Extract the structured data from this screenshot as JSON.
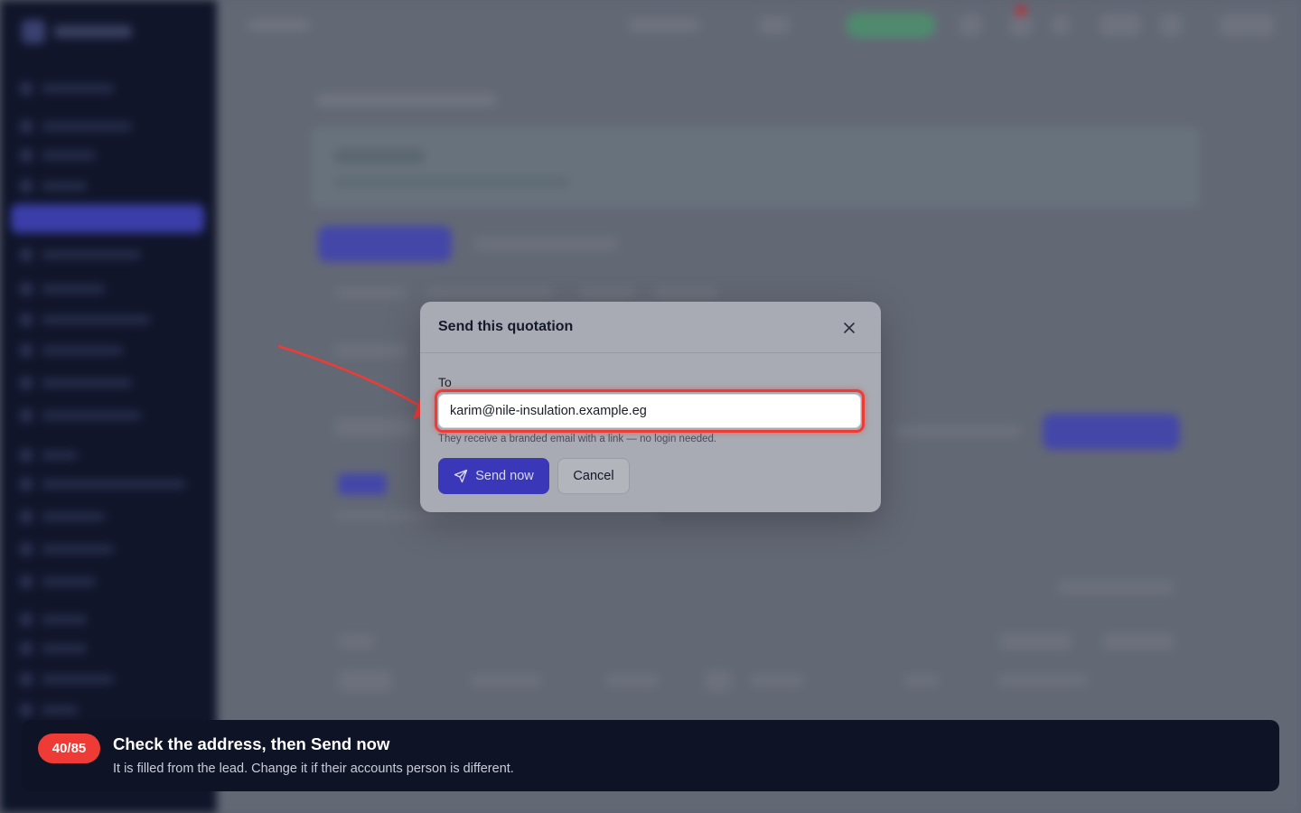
{
  "modal": {
    "title": "Send this quotation",
    "to_label": "To",
    "email_value": "karim@nile-insulation.example.eg",
    "helper_text": "They receive a branded email with a link — no login needed.",
    "send_label": "Send now",
    "cancel_label": "Cancel"
  },
  "tutorial": {
    "step": "40/85",
    "title": "Check the address, then Send now",
    "text": "It is filled from the lead. Change it if their accounts person is different."
  },
  "colors": {
    "highlight": "#ef3b36",
    "primary": "#3a37b8",
    "sidebar": "#10152a"
  },
  "icons": {
    "close": "close-icon",
    "send": "send-icon"
  }
}
